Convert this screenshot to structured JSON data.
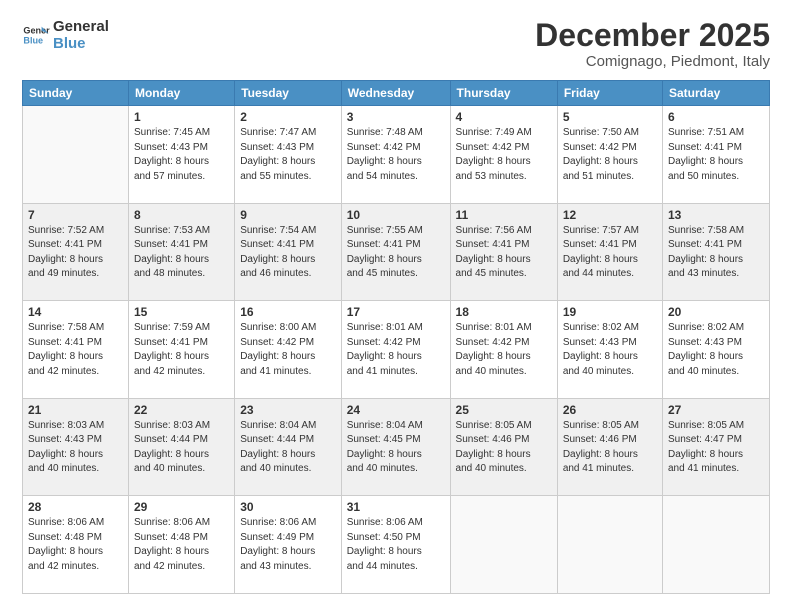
{
  "logo": {
    "line1": "General",
    "line2": "Blue"
  },
  "header": {
    "title": "December 2025",
    "subtitle": "Comignago, Piedmont, Italy"
  },
  "weekdays": [
    "Sunday",
    "Monday",
    "Tuesday",
    "Wednesday",
    "Thursday",
    "Friday",
    "Saturday"
  ],
  "weeks": [
    [
      {
        "day": "",
        "sunrise": "",
        "sunset": "",
        "daylight": ""
      },
      {
        "day": "1",
        "sunrise": "Sunrise: 7:45 AM",
        "sunset": "Sunset: 4:43 PM",
        "daylight": "Daylight: 8 hours and 57 minutes."
      },
      {
        "day": "2",
        "sunrise": "Sunrise: 7:47 AM",
        "sunset": "Sunset: 4:43 PM",
        "daylight": "Daylight: 8 hours and 55 minutes."
      },
      {
        "day": "3",
        "sunrise": "Sunrise: 7:48 AM",
        "sunset": "Sunset: 4:42 PM",
        "daylight": "Daylight: 8 hours and 54 minutes."
      },
      {
        "day": "4",
        "sunrise": "Sunrise: 7:49 AM",
        "sunset": "Sunset: 4:42 PM",
        "daylight": "Daylight: 8 hours and 53 minutes."
      },
      {
        "day": "5",
        "sunrise": "Sunrise: 7:50 AM",
        "sunset": "Sunset: 4:42 PM",
        "daylight": "Daylight: 8 hours and 51 minutes."
      },
      {
        "day": "6",
        "sunrise": "Sunrise: 7:51 AM",
        "sunset": "Sunset: 4:41 PM",
        "daylight": "Daylight: 8 hours and 50 minutes."
      }
    ],
    [
      {
        "day": "7",
        "sunrise": "Sunrise: 7:52 AM",
        "sunset": "Sunset: 4:41 PM",
        "daylight": "Daylight: 8 hours and 49 minutes."
      },
      {
        "day": "8",
        "sunrise": "Sunrise: 7:53 AM",
        "sunset": "Sunset: 4:41 PM",
        "daylight": "Daylight: 8 hours and 48 minutes."
      },
      {
        "day": "9",
        "sunrise": "Sunrise: 7:54 AM",
        "sunset": "Sunset: 4:41 PM",
        "daylight": "Daylight: 8 hours and 46 minutes."
      },
      {
        "day": "10",
        "sunrise": "Sunrise: 7:55 AM",
        "sunset": "Sunset: 4:41 PM",
        "daylight": "Daylight: 8 hours and 45 minutes."
      },
      {
        "day": "11",
        "sunrise": "Sunrise: 7:56 AM",
        "sunset": "Sunset: 4:41 PM",
        "daylight": "Daylight: 8 hours and 45 minutes."
      },
      {
        "day": "12",
        "sunrise": "Sunrise: 7:57 AM",
        "sunset": "Sunset: 4:41 PM",
        "daylight": "Daylight: 8 hours and 44 minutes."
      },
      {
        "day": "13",
        "sunrise": "Sunrise: 7:58 AM",
        "sunset": "Sunset: 4:41 PM",
        "daylight": "Daylight: 8 hours and 43 minutes."
      }
    ],
    [
      {
        "day": "14",
        "sunrise": "Sunrise: 7:58 AM",
        "sunset": "Sunset: 4:41 PM",
        "daylight": "Daylight: 8 hours and 42 minutes."
      },
      {
        "day": "15",
        "sunrise": "Sunrise: 7:59 AM",
        "sunset": "Sunset: 4:41 PM",
        "daylight": "Daylight: 8 hours and 42 minutes."
      },
      {
        "day": "16",
        "sunrise": "Sunrise: 8:00 AM",
        "sunset": "Sunset: 4:42 PM",
        "daylight": "Daylight: 8 hours and 41 minutes."
      },
      {
        "day": "17",
        "sunrise": "Sunrise: 8:01 AM",
        "sunset": "Sunset: 4:42 PM",
        "daylight": "Daylight: 8 hours and 41 minutes."
      },
      {
        "day": "18",
        "sunrise": "Sunrise: 8:01 AM",
        "sunset": "Sunset: 4:42 PM",
        "daylight": "Daylight: 8 hours and 40 minutes."
      },
      {
        "day": "19",
        "sunrise": "Sunrise: 8:02 AM",
        "sunset": "Sunset: 4:43 PM",
        "daylight": "Daylight: 8 hours and 40 minutes."
      },
      {
        "day": "20",
        "sunrise": "Sunrise: 8:02 AM",
        "sunset": "Sunset: 4:43 PM",
        "daylight": "Daylight: 8 hours and 40 minutes."
      }
    ],
    [
      {
        "day": "21",
        "sunrise": "Sunrise: 8:03 AM",
        "sunset": "Sunset: 4:43 PM",
        "daylight": "Daylight: 8 hours and 40 minutes."
      },
      {
        "day": "22",
        "sunrise": "Sunrise: 8:03 AM",
        "sunset": "Sunset: 4:44 PM",
        "daylight": "Daylight: 8 hours and 40 minutes."
      },
      {
        "day": "23",
        "sunrise": "Sunrise: 8:04 AM",
        "sunset": "Sunset: 4:44 PM",
        "daylight": "Daylight: 8 hours and 40 minutes."
      },
      {
        "day": "24",
        "sunrise": "Sunrise: 8:04 AM",
        "sunset": "Sunset: 4:45 PM",
        "daylight": "Daylight: 8 hours and 40 minutes."
      },
      {
        "day": "25",
        "sunrise": "Sunrise: 8:05 AM",
        "sunset": "Sunset: 4:46 PM",
        "daylight": "Daylight: 8 hours and 40 minutes."
      },
      {
        "day": "26",
        "sunrise": "Sunrise: 8:05 AM",
        "sunset": "Sunset: 4:46 PM",
        "daylight": "Daylight: 8 hours and 41 minutes."
      },
      {
        "day": "27",
        "sunrise": "Sunrise: 8:05 AM",
        "sunset": "Sunset: 4:47 PM",
        "daylight": "Daylight: 8 hours and 41 minutes."
      }
    ],
    [
      {
        "day": "28",
        "sunrise": "Sunrise: 8:06 AM",
        "sunset": "Sunset: 4:48 PM",
        "daylight": "Daylight: 8 hours and 42 minutes."
      },
      {
        "day": "29",
        "sunrise": "Sunrise: 8:06 AM",
        "sunset": "Sunset: 4:48 PM",
        "daylight": "Daylight: 8 hours and 42 minutes."
      },
      {
        "day": "30",
        "sunrise": "Sunrise: 8:06 AM",
        "sunset": "Sunset: 4:49 PM",
        "daylight": "Daylight: 8 hours and 43 minutes."
      },
      {
        "day": "31",
        "sunrise": "Sunrise: 8:06 AM",
        "sunset": "Sunset: 4:50 PM",
        "daylight": "Daylight: 8 hours and 44 minutes."
      },
      {
        "day": "",
        "sunrise": "",
        "sunset": "",
        "daylight": ""
      },
      {
        "day": "",
        "sunrise": "",
        "sunset": "",
        "daylight": ""
      },
      {
        "day": "",
        "sunrise": "",
        "sunset": "",
        "daylight": ""
      }
    ]
  ]
}
